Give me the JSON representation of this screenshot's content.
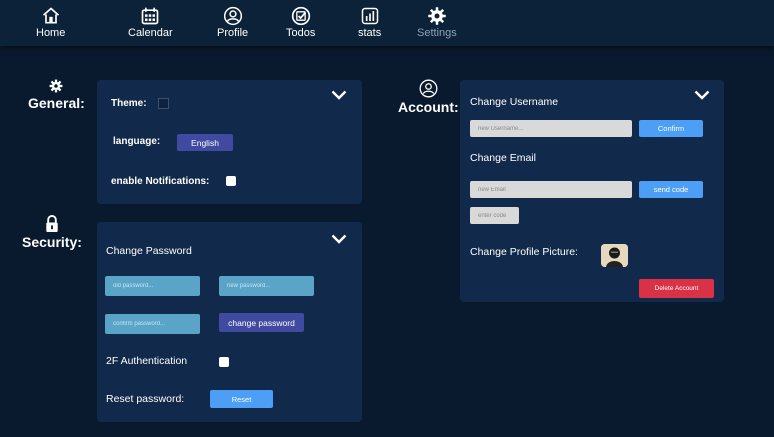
{
  "nav": {
    "home": "Home",
    "calendar": "Calendar",
    "profile": "Profile",
    "todos": "Todos",
    "stats": "stats",
    "settings": "Settings",
    "active": "settings"
  },
  "general": {
    "title": "General:",
    "theme_label": "Theme:",
    "language_label": "language:",
    "language_value": "English",
    "notifications_label": "enable Notifications:"
  },
  "security": {
    "title": "Security:",
    "change_password": "Change Password",
    "old_password_placeholder": "old password...",
    "new_password_placeholder": "new password...",
    "confirm_password_placeholder": "confirm password...",
    "change_password_button": "change password",
    "two_factor_label": "2F Authentication",
    "reset_label": "Reset password:",
    "reset_button": "Reset"
  },
  "account": {
    "title": "Account:",
    "change_username": "Change Username",
    "new_username_placeholder": "new Username...",
    "confirm_button": "Confirm",
    "change_email": "Change Email",
    "new_email_placeholder": "new Email",
    "send_code_button": "send code",
    "enter_code_placeholder": "enter code",
    "change_picture_label": "Change Profile Picture:",
    "delete_button": "Delete Account"
  },
  "colors": {
    "background": "#0a1a2e",
    "panel": "#11294a",
    "accent_blue": "#4d9ef5",
    "indigo": "#3f4aa0",
    "danger": "#d93246"
  }
}
